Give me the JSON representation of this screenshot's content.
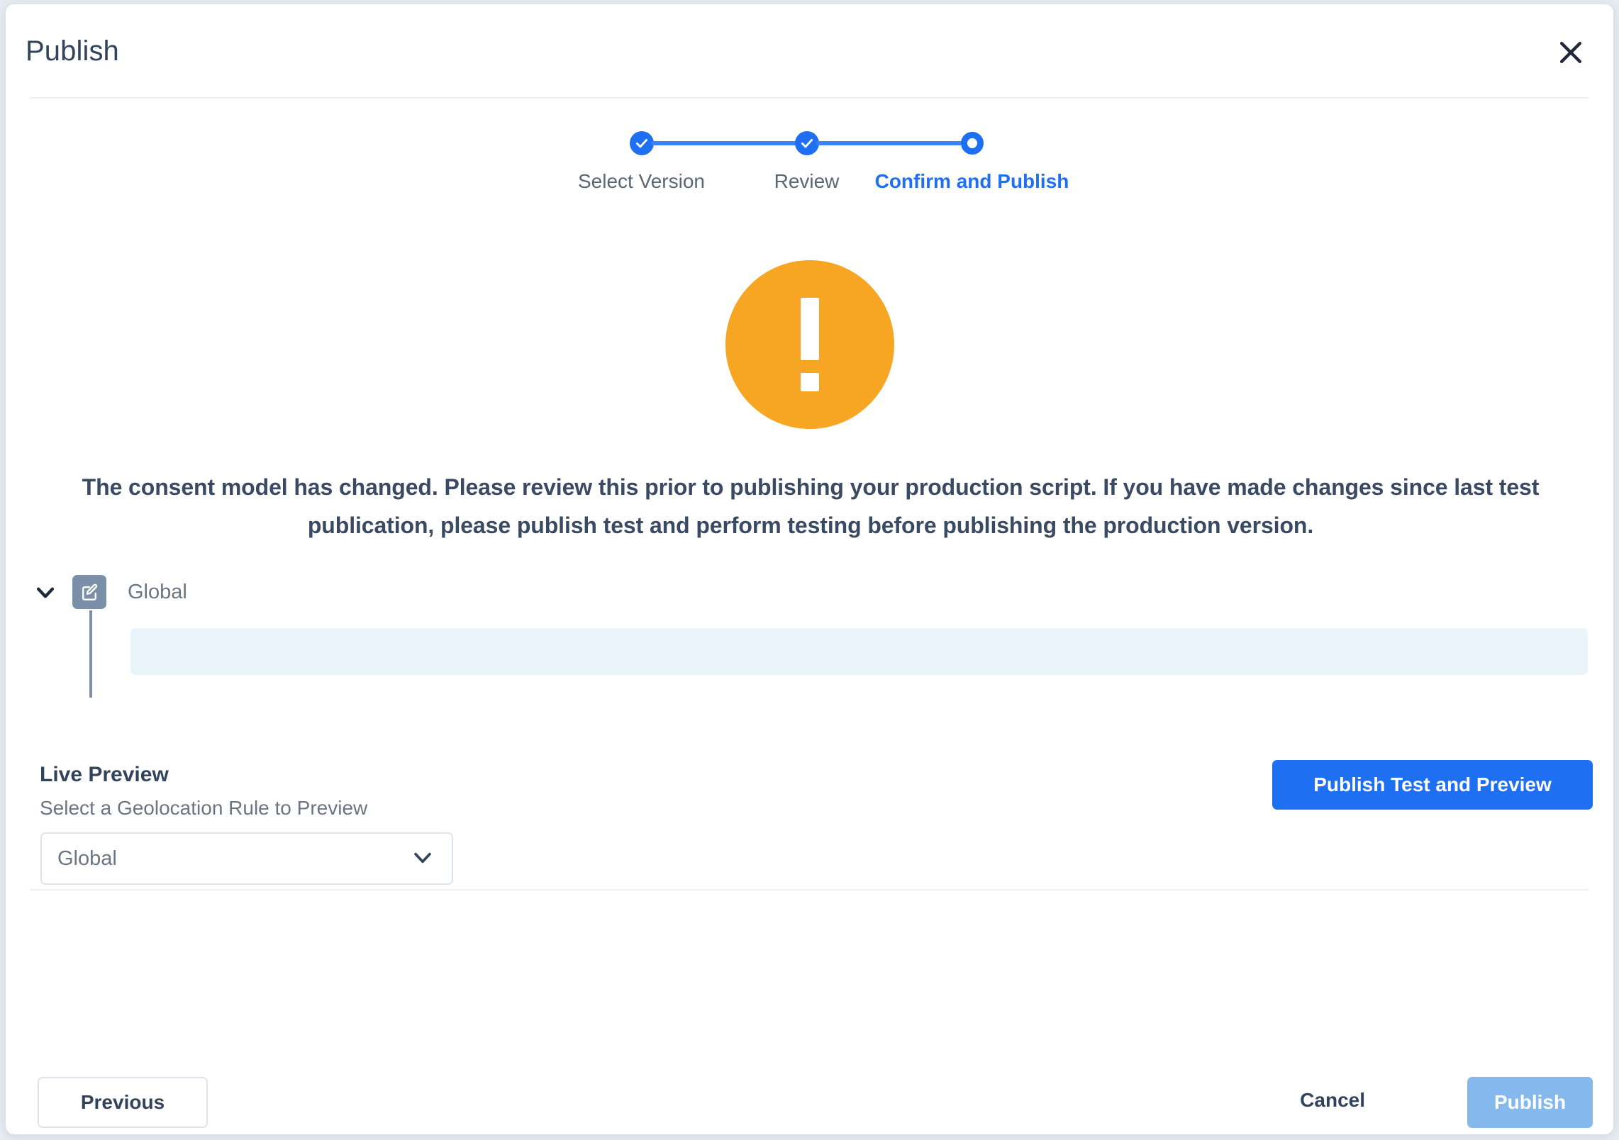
{
  "dialog": {
    "title": "Publish",
    "close_icon": "close-icon"
  },
  "stepper": {
    "steps": [
      {
        "label": "Select Version",
        "state": "done"
      },
      {
        "label": "Review",
        "state": "done"
      },
      {
        "label": "Confirm and Publish",
        "state": "current"
      }
    ],
    "active_color": "#1f6ff2"
  },
  "alert": {
    "icon": "exclamation-circle-icon",
    "icon_color": "#f6a623",
    "message": "The consent model has changed. Please review this prior to publishing your production script. If you have made changes since last test publication, please publish test and perform testing before publishing the production version."
  },
  "rule_tree": {
    "expand_icon": "chevron-down-icon",
    "edit_icon": "edit-square-icon",
    "edit_icon_color": "#7b8fa8",
    "name": "Global",
    "body_color": "#eaf4fb"
  },
  "live_preview": {
    "title": "Live Preview",
    "subtitle": "Select a Geolocation Rule to Preview",
    "select": {
      "value": "Global",
      "chevron_icon": "chevron-down-icon"
    },
    "publish_test_button": "Publish Test and Preview",
    "publish_test_button_color": "#1f6ff2"
  },
  "footer": {
    "previous": "Previous",
    "cancel": "Cancel",
    "publish": "Publish",
    "publish_disabled_color": "#85b8ec"
  }
}
